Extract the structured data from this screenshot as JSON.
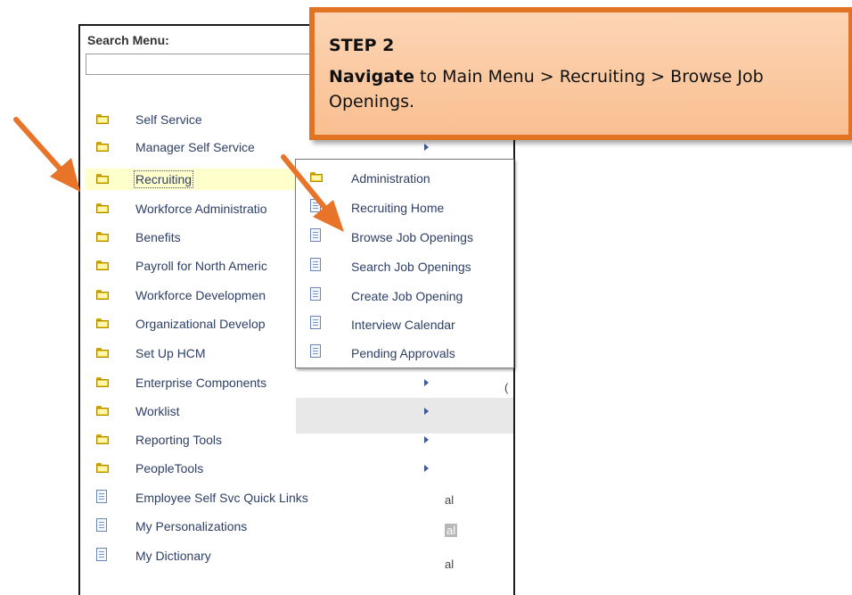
{
  "search": {
    "label": "Search Menu:",
    "value": ""
  },
  "menu": {
    "items": [
      {
        "label": "Self Service",
        "icon": "folder-icon",
        "has_submenu": true
      },
      {
        "label": "Manager Self Service",
        "icon": "folder-icon",
        "has_submenu": true
      },
      {
        "label": "Recruiting",
        "icon": "folder-icon",
        "has_submenu": true,
        "highlighted": true
      },
      {
        "label": "Workforce Administratio",
        "icon": "folder-icon",
        "has_submenu": true
      },
      {
        "label": "Benefits",
        "icon": "folder-icon",
        "has_submenu": true
      },
      {
        "label": "Payroll for North Americ",
        "icon": "folder-icon",
        "has_submenu": true
      },
      {
        "label": "Workforce Developmen",
        "icon": "folder-icon",
        "has_submenu": true
      },
      {
        "label": "Organizational Develop",
        "icon": "folder-icon",
        "has_submenu": true
      },
      {
        "label": "Set Up HCM",
        "icon": "folder-icon",
        "has_submenu": true
      },
      {
        "label": "Enterprise Components",
        "icon": "folder-icon",
        "has_submenu": true
      },
      {
        "label": "Worklist",
        "icon": "folder-icon",
        "has_submenu": true
      },
      {
        "label": "Reporting Tools",
        "icon": "folder-icon",
        "has_submenu": true
      },
      {
        "label": "PeopleTools",
        "icon": "folder-icon",
        "has_submenu": true
      },
      {
        "label": "Employee Self Svc Quick Links",
        "icon": "document-icon",
        "has_submenu": false
      },
      {
        "label": "My Personalizations",
        "icon": "document-icon",
        "has_submenu": false
      },
      {
        "label": "My Dictionary",
        "icon": "document-icon",
        "has_submenu": false
      }
    ]
  },
  "submenu": {
    "items": [
      {
        "label": "Administration",
        "icon": "folder-icon"
      },
      {
        "label": "Recruiting Home",
        "icon": "document-icon"
      },
      {
        "label": "Browse Job Openings",
        "icon": "document-icon"
      },
      {
        "label": "Search Job Openings",
        "icon": "document-icon"
      },
      {
        "label": "Create Job Opening",
        "icon": "document-icon"
      },
      {
        "label": "Interview Calendar",
        "icon": "document-icon"
      },
      {
        "label": "Pending Approvals",
        "icon": "document-icon"
      }
    ]
  },
  "background": {
    "fragments": [
      "(",
      "al",
      "al",
      "al"
    ]
  },
  "callout": {
    "title": "STEP 2",
    "bold_word": "Navigate",
    "body": " to Main Menu > Recruiting > Browse Job Openings."
  },
  "colors": {
    "callout_border": "#e27322",
    "callout_fill": "#f9bf90",
    "arrow": "#e8742a",
    "highlight": "#ffffcc",
    "link_text": "#2e3f66"
  }
}
